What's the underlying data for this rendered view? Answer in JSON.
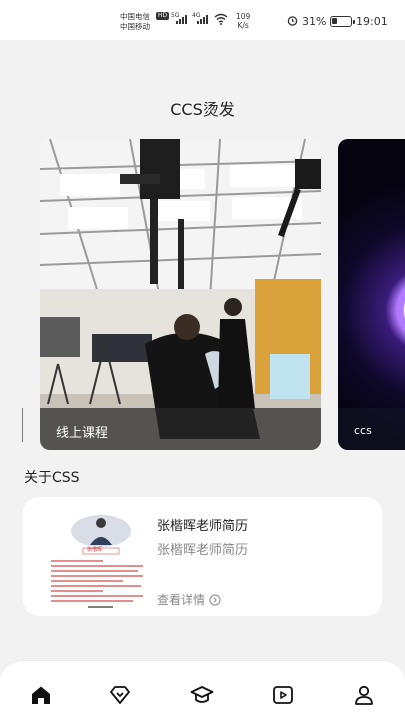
{
  "status_bar": {
    "carrier_1": "中国电信",
    "carrier_2": "中国移动",
    "hd": "HD",
    "net_1": "5G",
    "net_2": "4G",
    "speed_value": "109",
    "speed_unit": "K/s",
    "battery_percent": "31%",
    "battery_level": 0.31,
    "time": "19:01"
  },
  "header": {
    "title": "CCS烫发"
  },
  "carousel": {
    "slides": [
      {
        "caption": "线上课程"
      },
      {
        "caption": "ccs"
      }
    ]
  },
  "about": {
    "section_title": "关于CSS",
    "card": {
      "thumb_name": "张楷晖",
      "title": "张楷晖老师简历",
      "subtitle": "张楷晖老师简历",
      "details_label": "查看详情"
    }
  },
  "bottom_nav": {
    "items": [
      {
        "icon": "home-icon",
        "active": true
      },
      {
        "icon": "diamond-icon",
        "active": false
      },
      {
        "icon": "graduation-cap-icon",
        "active": false
      },
      {
        "icon": "video-play-icon",
        "active": false
      },
      {
        "icon": "user-icon",
        "active": false
      }
    ]
  },
  "colors": {
    "background": "#f2f2f2",
    "card": "#ffffff",
    "caption_overlay": "#282828",
    "muted_text": "#888888"
  }
}
